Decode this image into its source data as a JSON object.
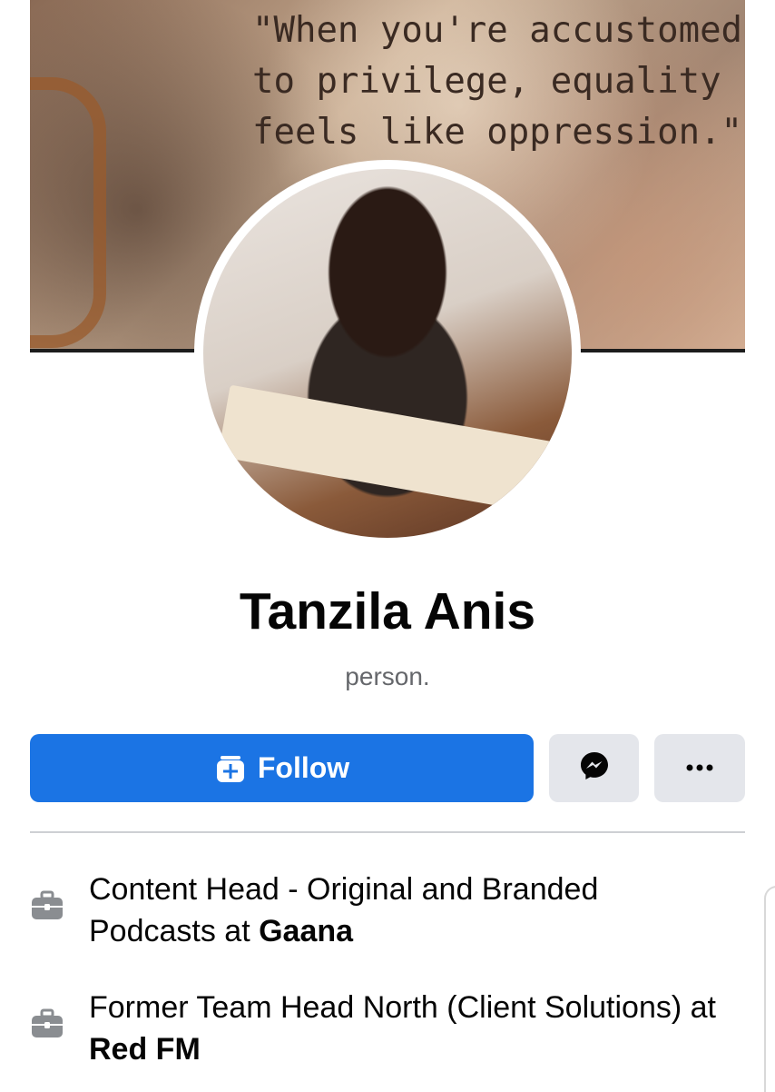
{
  "cover": {
    "quote": "\"When you're accustomed\nto privilege, equality\nfeels like oppression.\""
  },
  "profile": {
    "name": "Tanzila Anis",
    "subtitle": "person."
  },
  "actions": {
    "follow_label": "Follow",
    "follow_icon": "follow-plus-icon",
    "message_icon": "messenger-icon",
    "more_icon": "more-dots-icon",
    "accent_color": "#1b74e4"
  },
  "work": [
    {
      "title": "Content Head - Original and Branded Podcasts at ",
      "company": "Gaana",
      "icon": "briefcase-icon"
    },
    {
      "title": "Former Team Head North (Client Solutions) at ",
      "company": "Red FM",
      "icon": "briefcase-icon"
    }
  ]
}
